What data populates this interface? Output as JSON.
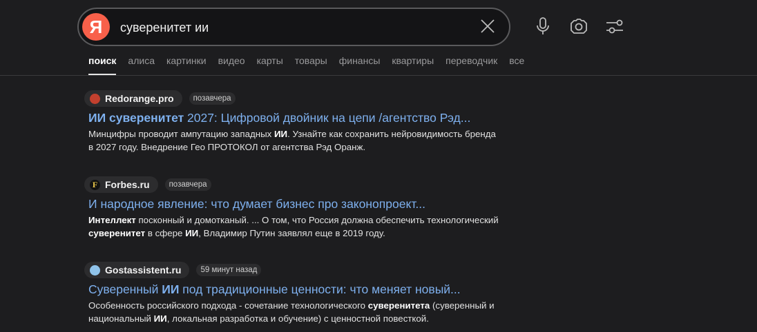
{
  "search": {
    "logo": "Я",
    "query": "суверенитет ии"
  },
  "tabs": [
    "поиск",
    "алиса",
    "картинки",
    "видео",
    "карты",
    "товары",
    "финансы",
    "квартиры",
    "переводчик",
    "все"
  ],
  "results": [
    {
      "source": "Redorange.pro",
      "favicon_color": "#c2402e",
      "time": "позавчера",
      "title": [
        {
          "t": "ИИ суверенитет",
          "b": true
        },
        {
          "t": " 2027: Цифровой двойник на цепи /агентство Рэд...",
          "b": false
        }
      ],
      "snippet": [
        {
          "t": "Минцифры проводит ампутацию западных ",
          "b": false
        },
        {
          "t": "ИИ",
          "b": true
        },
        {
          "t": ". Узнайте как сохранить нейровидимость бренда в 2027 году. Внедрение Гео ПРОТОКОЛ от агентства Рэд Оранж.",
          "b": false
        }
      ]
    },
    {
      "source": "Forbes.ru",
      "favicon_color": "#111111",
      "favicon_letter": "F",
      "time": "позавчера",
      "title": [
        {
          "t": "И народное явление: что думает бизнес про законопроект...",
          "b": false
        }
      ],
      "snippet": [
        {
          "t": "Интеллект",
          "b": true
        },
        {
          "t": " посконный и домотканый. ... О том, что Россия должна обеспечить технологический ",
          "b": false
        },
        {
          "t": "суверенитет",
          "b": true
        },
        {
          "t": " в сфере ",
          "b": false
        },
        {
          "t": "ИИ",
          "b": true
        },
        {
          "t": ", Владимир Путин заявлял еще в 2019 году.",
          "b": false
        }
      ]
    },
    {
      "source": "Gostassistent.ru",
      "favicon_color": "#8fc3ea",
      "time": "59 минут назад",
      "title": [
        {
          "t": "Суверенный ",
          "b": false
        },
        {
          "t": "ИИ",
          "b": true
        },
        {
          "t": " под традиционные ценности: что меняет новый...",
          "b": false
        }
      ],
      "snippet": [
        {
          "t": "Особенность российского подхода - сочетание технологического ",
          "b": false
        },
        {
          "t": "суверенитета",
          "b": true
        },
        {
          "t": " (суверенный и национальный ",
          "b": false
        },
        {
          "t": "ИИ",
          "b": true
        },
        {
          "t": ", локальная разработка и обучение) с ценностной повесткой.",
          "b": false
        }
      ]
    }
  ]
}
